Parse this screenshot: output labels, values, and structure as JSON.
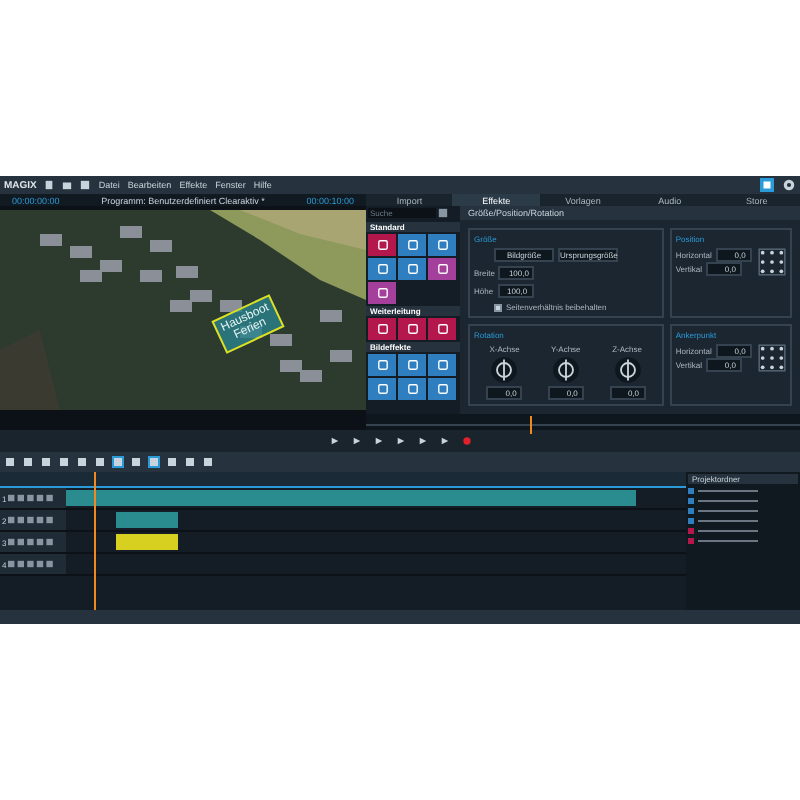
{
  "menu_bar": {
    "app_name": "MAGIX",
    "items": [
      "Datei",
      "Bearbeiten",
      "Effekte",
      "Fenster",
      "Hilfe"
    ]
  },
  "monitor": {
    "timecode_left": "00:00:00:00",
    "title": "Programm: Benutzerdefiniert Clearaktiv *",
    "timecode_right": "00:00:10:00",
    "overlay_text": "Hausboot Ferien"
  },
  "tabs": [
    {
      "label": "Import",
      "selected": false
    },
    {
      "label": "Effekte",
      "selected": true
    },
    {
      "label": "Vorlagen",
      "selected": false
    },
    {
      "label": "Audio",
      "selected": false
    },
    {
      "label": "Store",
      "selected": false
    }
  ],
  "effects_browser": {
    "search": {
      "placeholder": "Suche"
    },
    "categories": [
      {
        "name": "Standard",
        "tiles": [
          {
            "color": "#b3174c"
          },
          {
            "color": "#2f7fc0"
          },
          {
            "color": "#2f7fc0"
          },
          {
            "color": "#2f7fc0"
          },
          {
            "color": "#2f7fc0"
          },
          {
            "color": "#a53f9c"
          },
          {
            "color": "#a53f9c"
          }
        ]
      },
      {
        "name": "Weiterleitung",
        "tiles": [
          {
            "color": "#b3174c"
          },
          {
            "color": "#b3174c"
          },
          {
            "color": "#b3174c"
          }
        ]
      },
      {
        "name": "Bildeffekte",
        "tiles": [
          {
            "color": "#2f7fc0"
          },
          {
            "color": "#2f7fc0"
          },
          {
            "color": "#2f7fc0"
          },
          {
            "color": "#2f7fc0"
          },
          {
            "color": "#2f7fc0"
          },
          {
            "color": "#2f7fc0"
          }
        ]
      }
    ]
  },
  "settings": {
    "title": "Größe/Position/Rotation",
    "sections": [
      {
        "kind": "size",
        "title": "Größe",
        "buttons": [
          "Bildgröße",
          "Ursprungsgröße"
        ],
        "fields": [
          {
            "label": "Breite",
            "value": "100,0"
          },
          {
            "label": "Höhe",
            "value": "100,0"
          }
        ],
        "checkbox": {
          "label": "Seitenverhältnis beibehalten",
          "checked": true
        }
      },
      {
        "kind": "position",
        "title": "Position",
        "fields": [
          {
            "label": "Horizontal",
            "value": "0,0"
          },
          {
            "label": "Vertikal",
            "value": "0,0"
          }
        ]
      },
      {
        "kind": "rotation",
        "title": "Rotation",
        "dials": [
          {
            "label": "X-Achse",
            "value": "0,0"
          },
          {
            "label": "Y-Achse",
            "value": "0,0"
          },
          {
            "label": "Z-Achse",
            "value": "0,0"
          }
        ]
      },
      {
        "kind": "position",
        "title": "Ankerpunkt",
        "fields": [
          {
            "label": "Horizontal",
            "value": "0,0"
          },
          {
            "label": "Vertikal",
            "value": "0,0"
          }
        ]
      }
    ]
  },
  "timeline": {
    "tracks": [
      {
        "number": "1",
        "clips": [
          {
            "color": "#2b8c8f"
          }
        ]
      },
      {
        "number": "2",
        "clips": [
          {
            "color": "#2b8c8f"
          }
        ]
      },
      {
        "number": "3",
        "clips": [
          {
            "color": "#d8d021"
          }
        ]
      },
      {
        "number": "4"
      }
    ]
  },
  "media_pool": {
    "title": "Projektordner",
    "files": [
      {
        "color": "#2f7fc0"
      },
      {
        "color": "#2f7fc0"
      },
      {
        "color": "#2f7fc0"
      },
      {
        "color": "#2f7fc0"
      },
      {
        "color": "#b3174c"
      },
      {
        "color": "#b3174c"
      }
    ]
  }
}
